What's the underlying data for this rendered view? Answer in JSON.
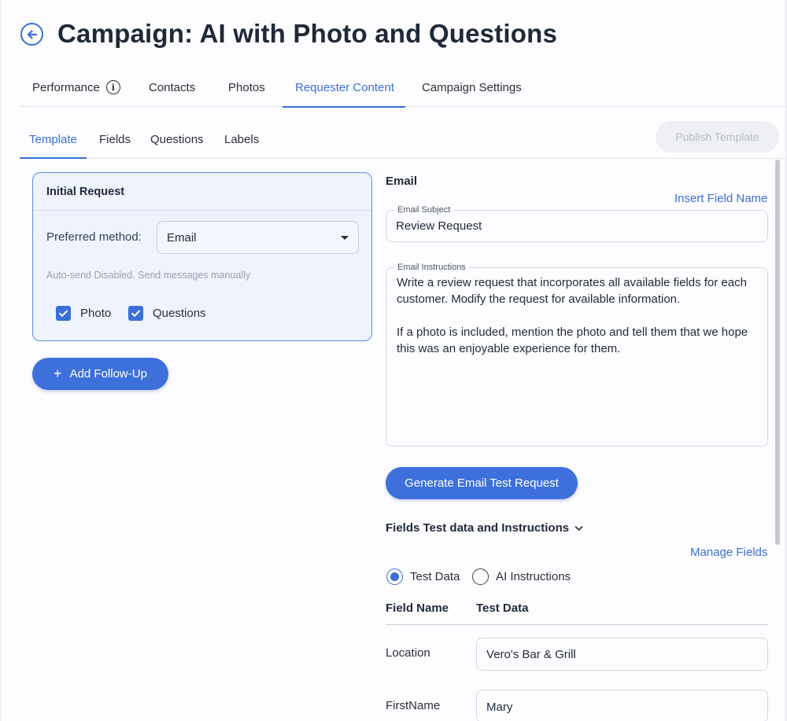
{
  "header": {
    "title": "Campaign: AI with Photo and Questions",
    "back_icon": "arrow-left-circle-icon"
  },
  "main_tabs": [
    {
      "label": "Performance",
      "icon": "info-icon",
      "active": false
    },
    {
      "label": "Contacts",
      "active": false
    },
    {
      "label": "Photos",
      "active": false
    },
    {
      "label": "Requester Content",
      "active": true
    },
    {
      "label": "Campaign Settings",
      "active": false
    }
  ],
  "info_icon_glyph": "i",
  "sub_tabs": [
    {
      "label": "Template",
      "active": true
    },
    {
      "label": "Fields",
      "active": false
    },
    {
      "label": "Questions",
      "active": false
    },
    {
      "label": "Labels",
      "active": false
    }
  ],
  "publish_button": {
    "label": "Publish Template",
    "disabled": true
  },
  "request_card": {
    "title": "Initial Request",
    "preferred_method_label": "Preferred method:",
    "preferred_method_value": "Email",
    "auto_send_note": "Auto-send Disabled. Send messages manually",
    "checkboxes": [
      {
        "label": "Photo",
        "checked": true
      },
      {
        "label": "Questions",
        "checked": true
      }
    ]
  },
  "add_followup": {
    "plus": "+",
    "label": "Add Follow-Up"
  },
  "email": {
    "heading": "Email",
    "insert_field_link": "Insert Field Name",
    "subject_label": "Email Subject",
    "subject_value": "Review Request",
    "instructions_label": "Email Instructions",
    "instructions_value": "Write a review request that incorporates all available fields for each customer. Modify the request for available information.\n\nIf a photo is included, mention the photo and tell them that we hope this was an enjoyable experience for them.",
    "generate_button": "Generate Email Test Request"
  },
  "fields_section": {
    "toggle_label": "Fields Test data and Instructions",
    "manage_link": "Manage Fields",
    "radio_test_data": "Test Data",
    "radio_ai_instructions": "AI Instructions",
    "selected": "Test Data",
    "columns": [
      "Field Name",
      "Test Data"
    ],
    "rows": [
      {
        "name": "Location",
        "value": "Vero's Bar & Grill"
      },
      {
        "name": "FirstName",
        "value": "Mary"
      }
    ]
  },
  "colors": {
    "accent": "#3a6fd8",
    "card_bg": "#eef3fd",
    "disabled_bg": "#eef0f3"
  }
}
